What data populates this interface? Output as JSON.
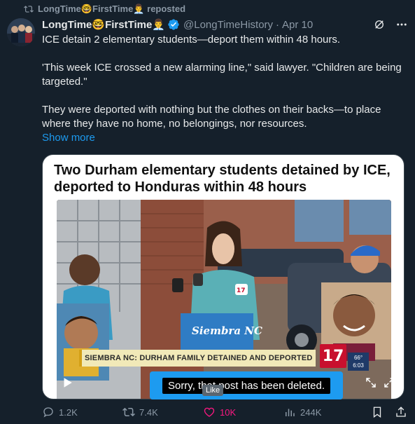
{
  "repost": {
    "label": "LongTime🤓FirstTime👨‍💼 reposted"
  },
  "tweet": {
    "display_name": "LongTime🤓FirstTime👨‍💼",
    "handle": "@LongTimeHistory",
    "separator": "·",
    "date": "Apr 10",
    "paragraphs": [
      "ICE detain 2 elementary students—deport them within 48 hours.",
      "'This week ICE crossed a new alarming line,\" said lawyer. \"Children are being targeted.\"",
      "They were deported with nothing but the clothes on their backs—to place where they have no home, no belongings, nor resources."
    ],
    "show_more": "Show more"
  },
  "card": {
    "headline": "Two Durham elementary students detained by ICE, deported to Honduras within 48 hours",
    "lower_third": "SIEMBRA NC: DURHAM FAMILY DETAINED AND DEPORTED",
    "channel_logo": "17",
    "weather_temp": "66°",
    "weather_time": "6:03",
    "sign_text": "Siembra NC"
  },
  "toast": {
    "message": "Sorry, that post has been deleted."
  },
  "tooltip": {
    "label": "Like"
  },
  "actions": {
    "replies": "1.2K",
    "reposts": "7.4K",
    "likes": "10K",
    "views": "244K"
  },
  "colors": {
    "background": "#15202b",
    "accent": "#1d9bf0",
    "muted": "#8b98a5",
    "like": "#f91880"
  }
}
